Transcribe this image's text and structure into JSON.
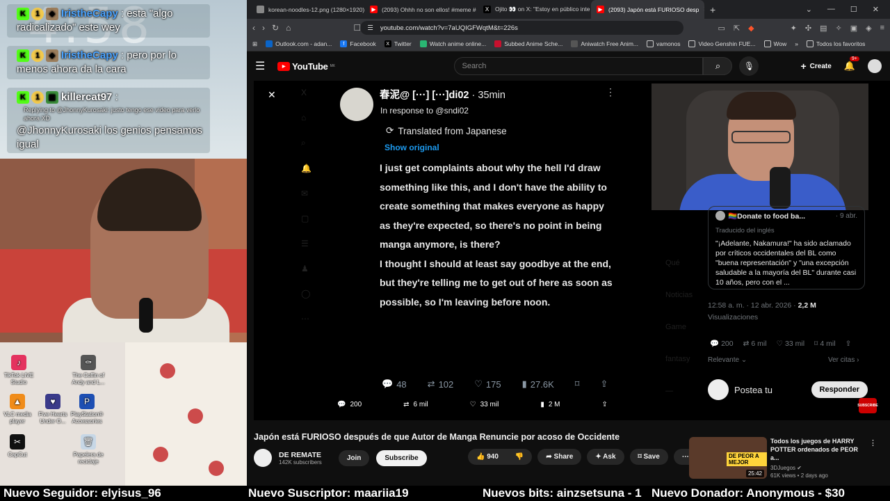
{
  "stream": {
    "clock": "4:58",
    "chat": [
      {
        "user": "IristheCapy",
        "text": ": esta \"algo radicalizado\" este wey"
      },
      {
        "user": "IristheCapy",
        "text": ": pero por lo menos ahora da la cara"
      },
      {
        "user": "killercat97",
        "text": ":",
        "reply": "Replying to @JhonnyKurosaki: justo tengo ese video para verlo ahora XD",
        "text2": "@JhonnyKurosaki los genios pensamos igual"
      }
    ],
    "desktop_icons": [
      {
        "label": "TikTok LIVE Studio",
        "icon": "tiktok-icon",
        "color": "#e4325f"
      },
      {
        "label": "The Coffin of Andy and L...",
        "icon": "game-icon",
        "color": "#555555"
      },
      {
        "label": "VLC media player",
        "icon": "vlc-icon",
        "color": "#f08c1a"
      },
      {
        "label": "Five Hearts Under O...",
        "icon": "game-icon",
        "color": "#3a3a8a"
      },
      {
        "label": "PlayStation® Accessories",
        "icon": "playstation-icon",
        "color": "#1e4fb3"
      },
      {
        "label": "CapCut",
        "icon": "capcut-icon",
        "color": "#111111"
      },
      {
        "label": "Papelera de reciclaje",
        "icon": "recycle-bin-icon",
        "color": "#c7d7e6"
      }
    ],
    "ticker": {
      "follower": "Nuevo Seguidor: elyisus_96",
      "subscriber": "Nuevo Suscriptor: maariia19",
      "bits": "Nuevos bits: ainzsetsuna - 1",
      "donor": "Nuevo Donador: Anonymous - $30"
    }
  },
  "browser": {
    "tabs": [
      {
        "label": "korean-noodles-12.png (1280×1920)",
        "icon": "image-icon",
        "color": "#888888"
      },
      {
        "label": "(2093) Ohhh no son ellos! #meme #",
        "icon": "youtube-icon",
        "color": "#ff0000"
      },
      {
        "label": "Ojito 👀 on X: \"Estoy en público inte",
        "icon": "x-icon",
        "color": "#000000"
      },
      {
        "label": "(2093) Japón está FURIOSO desp",
        "icon": "youtube-icon",
        "color": "#ff0000",
        "active": true
      }
    ],
    "url": "youtube.com/watch?v=7aUQIGFWqtM&t=226s",
    "bookmarks": [
      {
        "label": "Outlook.com - adan...",
        "icon": "outlook-icon",
        "color": "#0a64c8"
      },
      {
        "label": "Facebook",
        "icon": "facebook-icon",
        "color": "#1877f2"
      },
      {
        "label": "Twitter",
        "icon": "x-icon",
        "color": "#000000"
      },
      {
        "label": "Watch anime online...",
        "icon": "anime-icon",
        "color": "#2ab673"
      },
      {
        "label": "Subbed Anime Sche...",
        "icon": "anime-icon",
        "color": "#c8102e"
      },
      {
        "label": "Aniwatch Free Anim...",
        "icon": "anime-icon",
        "color": "#555555"
      },
      {
        "label": "vamonos",
        "icon": "folder-icon",
        "color": "#cccccc"
      },
      {
        "label": "Video Genshin FUE...",
        "icon": "folder-icon",
        "color": "#cccccc"
      },
      {
        "label": "Wow",
        "icon": "folder-icon",
        "color": "#cccccc"
      },
      {
        "label": "Todos los favoritos",
        "icon": "folder-icon",
        "color": "#cccccc"
      }
    ]
  },
  "youtube": {
    "logo": "YouTube",
    "region": "MX",
    "search_placeholder": "Search",
    "create_label": "Create",
    "notif_count": "9+",
    "video_title": "Japón está FURIOSO después de que Autor de Manga Renuncie por acoso de Occidente",
    "channel": {
      "name": "DE REMATE",
      "subs": "142K subscribers"
    },
    "join_label": "Join",
    "subscribe_label": "Subscribe",
    "likes": "940",
    "share_label": "Share",
    "ask_label": "Ask",
    "save_label": "Save",
    "recommended": {
      "title": "Todos los juegos de HARRY POTTER ordenados de PEOR a...",
      "channel": "3DJuegos",
      "meta": "61K views • 2 days ago",
      "duration": "25:42",
      "thumb_label": "DE PEOR A MEJOR"
    }
  },
  "tweet": {
    "author": "春泥@ [···] [···]di02",
    "time": "35min",
    "reply_to": "In response to @sndi02",
    "translated": "Translated from Japanese",
    "show_original": "Show original",
    "paragraphs": [
      "I just get complaints about why the hell I'd draw something like this, and I don't have the ability to create something that makes everyone as happy as they're expected, so there's no point in being manga anymore, is there?",
      "I thought I should at least say goodbye at the end, but they're telling me to get out of here as soon as possible, so I'm leaving before noon."
    ],
    "actions": {
      "replies": "48",
      "reposts": "102",
      "likes": "175",
      "views": "27.6K"
    },
    "ghost_actions": {
      "replies": "200",
      "reposts": "6 mil",
      "likes": "33 mil",
      "views": "2 M"
    }
  },
  "embed": {
    "user": "🏳️‍🌈Donate to food ba...",
    "date": "· 9 abr.",
    "translated": "Traducido del inglés",
    "text": "\"¡Adelante, Nakamura!\" ha sido aclamado por críticos occidentales del BL como \"buena representación\" y \"una excepción saludable a la mayoría del BL\" durante casi 10 años, pero con el ...",
    "time": "12:58 a. m. · 12 abr. 2026 · ",
    "views_count": "2,2 M",
    "views_label": "Visualizaciones",
    "actions": {
      "replies": "200",
      "reposts": "6 mil",
      "likes": "33 mil",
      "bookmarks": "4 mil"
    },
    "relevante": "Relevante",
    "ver_citas": "Ver citas",
    "reply_placeholder": "Postea tu",
    "reply_button": "Responder"
  }
}
